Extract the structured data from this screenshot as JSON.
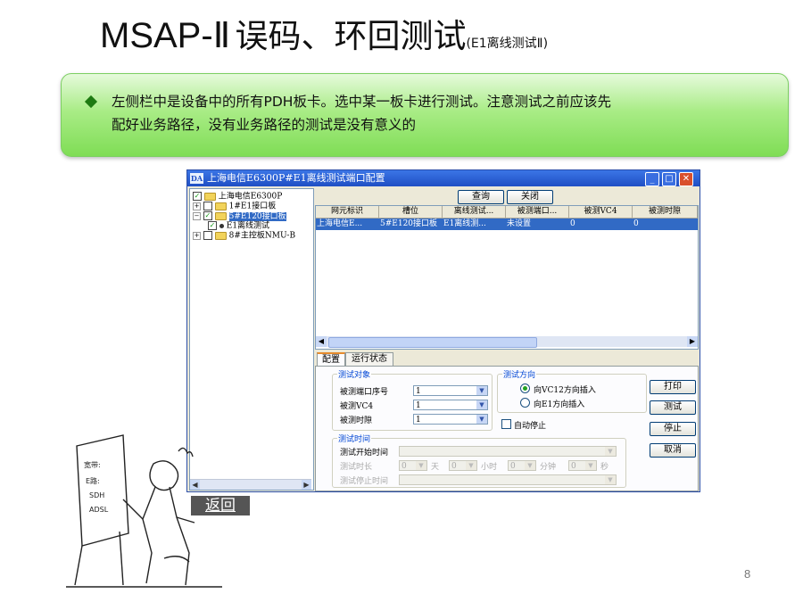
{
  "slide": {
    "title_main": "MSAP-Ⅱ",
    "title_zh": "误码、环回测试",
    "title_sub": "(E1离线测试Ⅱ)",
    "note_line1": "左侧栏中是设备中的所有PDH板卡。选中某一板卡进行测试。注意测试之前应该先",
    "note_line2": "配好业务路径，没有业务路径的测试是没有意义的",
    "back_label": "返回",
    "page_number": "8"
  },
  "window": {
    "title": "上海电信E6300P#E1离线测试端口配置",
    "app_icon": "DA",
    "min_icon": "minimize-icon",
    "max_icon": "maximize-icon",
    "close_icon": "close-icon",
    "tree": [
      {
        "label": "上海电信E6300P",
        "checked": true
      },
      {
        "label": "1#E1接口板",
        "checked": false
      },
      {
        "label": "5#E120接口板",
        "checked": true,
        "selected": true
      },
      {
        "label": "E1离线测试",
        "checked": true
      },
      {
        "label": "8#主控板NMU-B",
        "checked": false
      }
    ],
    "buttons": {
      "query": "查询",
      "close": "关闭"
    },
    "table": {
      "headers": [
        "网元标识",
        "槽位",
        "离线测试...",
        "被测端口...",
        "被测VC4",
        "被测时隙"
      ],
      "rows": [
        [
          "上海电信E...",
          "5#E120接口板",
          "E1离线测...",
          "未设置",
          "0",
          "0"
        ]
      ]
    },
    "tabs": [
      "配置",
      "运行状态"
    ],
    "config": {
      "test_object_label": "测试对象",
      "port_label": "被测端口序号",
      "port_value": "1",
      "vc4_label": "被测VC4",
      "vc4_value": "1",
      "slot_label": "被测时隙",
      "slot_value": "1",
      "direction_label": "测试方向",
      "dir_vc12": "向VC12方向插入",
      "dir_e1": "向E1方向插入",
      "auto_stop": "自动停止",
      "time_group": "测试时间",
      "start_time": "测试开始时间",
      "duration": "测试时长",
      "stop_time": "测试停止时间",
      "dur_day_value": "0",
      "day_unit": "天",
      "dur_hour_value": "0",
      "hour_unit": "小时",
      "dur_min_value": "0",
      "min_unit": "分钟",
      "dur_sec_value": "0",
      "sec_unit": "秒"
    },
    "side_buttons": {
      "print": "打印",
      "test": "测试",
      "stop": "停止",
      "cancel": "取消"
    }
  },
  "cartoon": {
    "board_lines": [
      "宽带:",
      "E路:",
      "SDH",
      "ADSL"
    ]
  },
  "colors": {
    "title_bar": "#1f4fc4",
    "selection": "#316ac5",
    "note_green": "#7fdd55"
  }
}
